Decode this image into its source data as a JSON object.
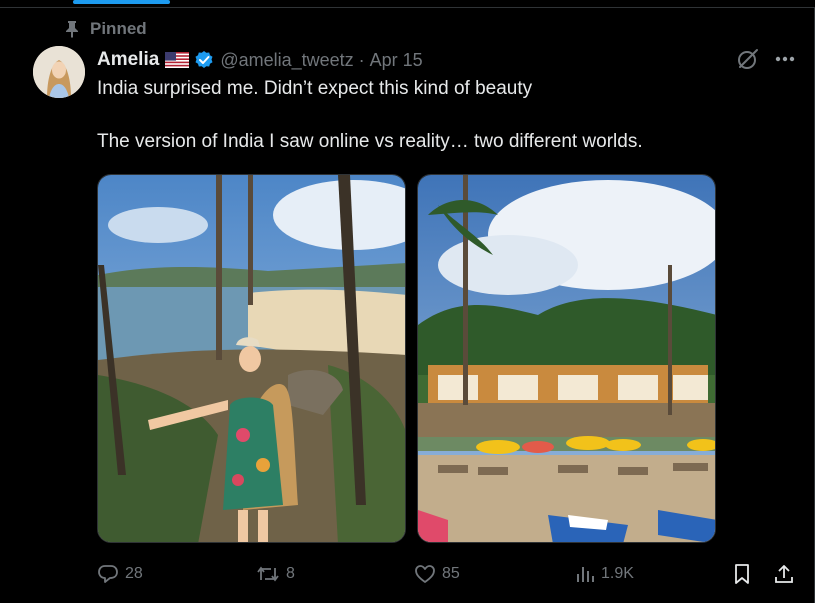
{
  "pinned": {
    "label": "Pinned",
    "icon": "pin-icon"
  },
  "author": {
    "display_name": "Amelia",
    "flag_icon": "us-flag-icon",
    "verified_icon": "verified-badge-icon",
    "handle": "@amelia_tweetz",
    "separator": "·",
    "date": "Apr 15"
  },
  "header_actions": {
    "grok_icon": "grok-icon",
    "more_icon": "more-icon"
  },
  "tweet": {
    "line1": "India surprised me. Didn’t expect this kind of beauty",
    "line2": "The version of India I saw online vs reality… two different worlds."
  },
  "media": [
    {
      "kind": "photo",
      "subject": "woman-on-beach-cliff"
    },
    {
      "kind": "photo",
      "subject": "beach-huts-kayaks"
    }
  ],
  "actions": {
    "reply_count": "28",
    "repost_count": "8",
    "like_count": "85",
    "view_count": "1.9K"
  },
  "colors": {
    "background": "#000000",
    "text_primary": "#e7e9ea",
    "text_secondary": "#71767b",
    "accent": "#1d9bf0",
    "border": "#2f3336"
  }
}
